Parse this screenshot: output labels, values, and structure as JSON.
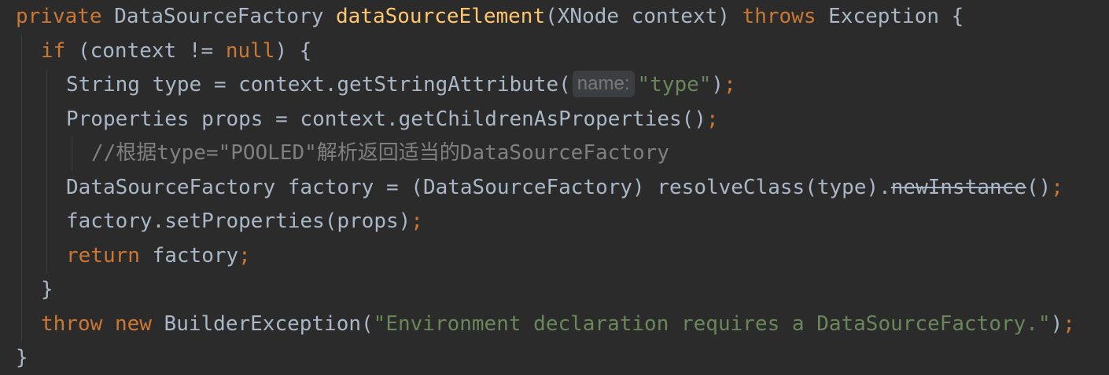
{
  "code": {
    "line1": {
      "kw_private": "private",
      "sp1": " ",
      "type_ret": "DataSourceFactory",
      "sp2": " ",
      "method": "dataSourceElement",
      "params": "(XNode context) ",
      "kw_throws": "throws",
      "tail": " Exception {"
    },
    "line2": {
      "kw_if": "if",
      "a": " (context != ",
      "kw_null": "null",
      "b": ") {"
    },
    "line3": {
      "a": "String type = context.getStringAttribute(",
      "hint": "name:",
      "str": "\"type\"",
      "b": ")",
      "semi": ";"
    },
    "line4": {
      "a": "Properties props = context.getChildrenAsProperties()",
      "semi": ";"
    },
    "line5": {
      "comment": "//根据type=\"POOLED\"解析返回适当的DataSourceFactory"
    },
    "line6": {
      "a": "DataSourceFactory factory = (DataSourceFactory) resolveClass(type).",
      "deprecated": "newInstance",
      "b": "()",
      "semi": ";"
    },
    "line7": {
      "a": "factory.setProperties(props)",
      "semi": ";"
    },
    "line8": {
      "kw_return": "return",
      "a": " factory",
      "semi": ";"
    },
    "line9": {
      "a": "}"
    },
    "line10": {
      "kw_throw": "throw",
      "sp": " ",
      "kw_new": "new",
      "a": " BuilderException(",
      "str": "\"Environment declaration requires a DataSourceFactory.\"",
      "b": ")",
      "semi": ";"
    },
    "line11": {
      "a": "}"
    }
  },
  "colors": {
    "background": "#2b2b2b",
    "default_text": "#a9b7c6",
    "keyword": "#cc7832",
    "method_declaration": "#ffc66d",
    "string": "#6a8759",
    "comment": "#808080",
    "param_hint_bg": "#3b3f41",
    "param_hint_text": "#787878"
  }
}
